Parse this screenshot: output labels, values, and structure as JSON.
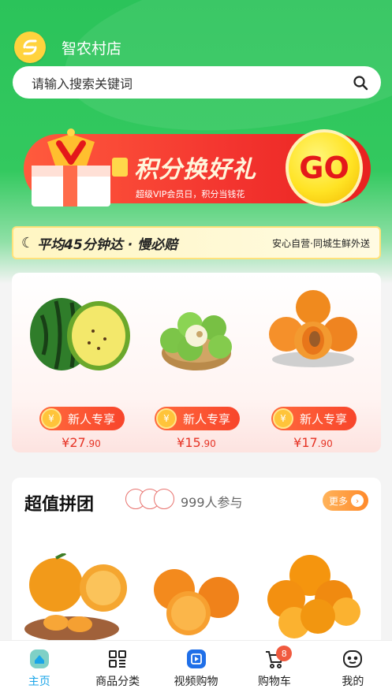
{
  "header": {
    "shop_name": "智农村店"
  },
  "search": {
    "placeholder": "请输入搜索关键词"
  },
  "banner": {
    "title": "积分换好礼",
    "subtitle": "超级VIP会员日，积分当钱花",
    "go_label": "GO"
  },
  "promo": {
    "main": "平均45分钟达 · 慢必赔",
    "side": "安心自营·同城生鲜外送"
  },
  "new_user_products": [
    {
      "name": "watermelon",
      "badge": "新人专享",
      "price_int": "¥27",
      "price_dec": ".90"
    },
    {
      "name": "jujube",
      "badge": "新人专享",
      "price_int": "¥15",
      "price_dec": ".90"
    },
    {
      "name": "apricot",
      "badge": "新人专享",
      "price_int": "¥17",
      "price_dec": ".90"
    }
  ],
  "group_buy": {
    "title": "超值拼团",
    "participants": "999人参与",
    "more_label": "更多"
  },
  "tabs": [
    {
      "label": "主页",
      "icon": "home-icon",
      "active": true
    },
    {
      "label": "商品分类",
      "icon": "category-icon"
    },
    {
      "label": "视频购物",
      "icon": "video-icon"
    },
    {
      "label": "购物车",
      "icon": "cart-icon",
      "badge": "8"
    },
    {
      "label": "我的",
      "icon": "profile-icon"
    }
  ],
  "colors": {
    "green": "#2bc35a",
    "red": "#e63426",
    "blue_active": "#1aa5e8"
  }
}
